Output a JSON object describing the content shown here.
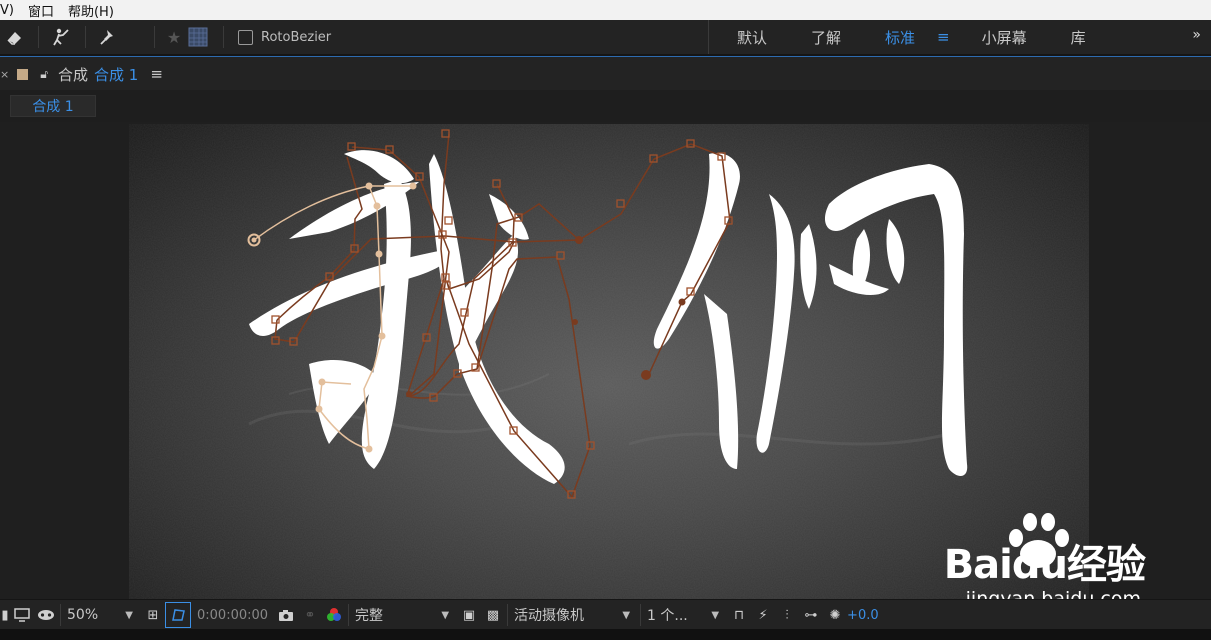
{
  "menubar": {
    "items": [
      "V)",
      "窗口",
      "帮助(H)"
    ]
  },
  "toolbar": {
    "rotobezier_label": "RotoBezier"
  },
  "workspace": {
    "items": [
      "默认",
      "了解",
      "标准",
      "小屏幕",
      "库"
    ],
    "active": "标准"
  },
  "panel": {
    "label": "合成",
    "comp_name": "合成 1",
    "tab_label": "合成 1"
  },
  "canvas_text": {
    "characters": "我們"
  },
  "viewer_controls": {
    "zoom": "50%",
    "timecode": "0:00:00:00",
    "resolution": "完整",
    "camera": "活动摄像机",
    "views": "1 个...",
    "exposure": "+0.0"
  },
  "watermark": {
    "brand": "Baidu经验",
    "url": "jingyan.baidu.com"
  },
  "colors": {
    "accent": "#3b8fe5",
    "path_dark": "#7a3b1f",
    "path_light": "#e3bf9c"
  }
}
